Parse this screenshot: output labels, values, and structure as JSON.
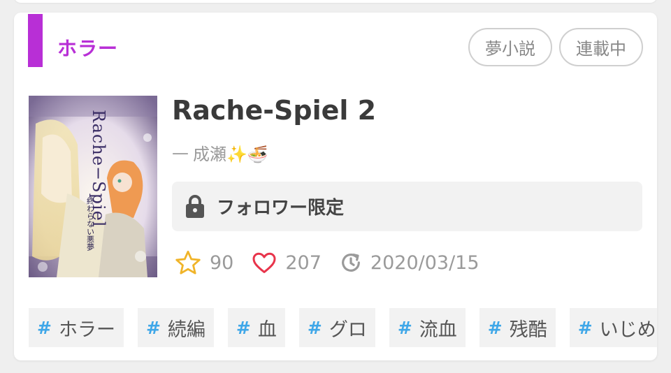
{
  "genre": {
    "label": "ホラー",
    "color": "#b82fd6"
  },
  "badges": [
    "夢小説",
    "連載中"
  ],
  "novel": {
    "title": "Rache-Spiel 2",
    "author_prefix": "—",
    "author_name": "成瀬✨🍜",
    "cover": {
      "title_text": "Rache−Spiel",
      "subtitle_text": "終わらない悪夢"
    },
    "access_label": "フォロワー限定"
  },
  "stats": {
    "stars": "90",
    "likes": "207",
    "updated": "2020/03/15"
  },
  "tags": [
    "ホラー",
    "続編",
    "血",
    "グロ",
    "流血",
    "残酷",
    "いじめ"
  ],
  "colors": {
    "accent": "#b82fd6",
    "star": "#f0b429",
    "heart": "#e8344b",
    "hash": "#3fa7e8"
  }
}
